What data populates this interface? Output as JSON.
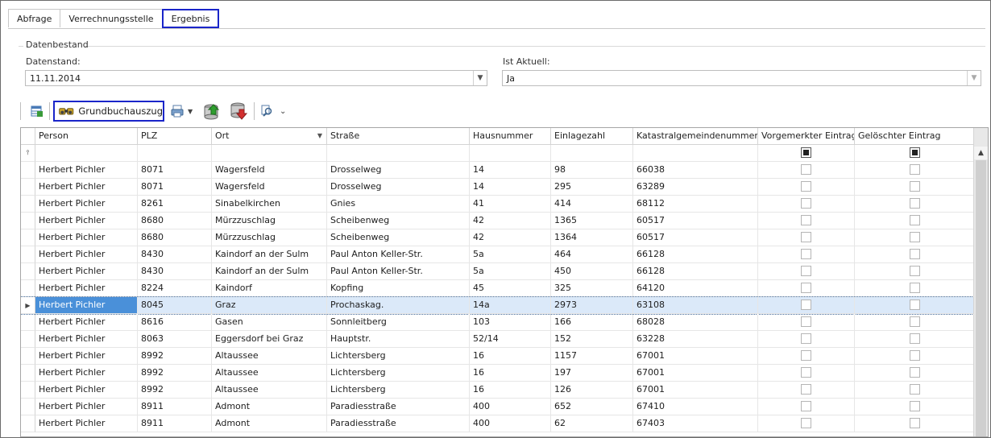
{
  "tabs": [
    {
      "label": "Abfrage",
      "active": false
    },
    {
      "label": "Verrechnungsstelle",
      "active": false
    },
    {
      "label": "Ergebnis",
      "active": true
    }
  ],
  "datenbestand": {
    "legend": "Datenbestand",
    "datenstand_label": "Datenstand:",
    "datenstand_value": "11.11.2014",
    "ist_aktuell_label": "Ist Aktuell:",
    "ist_aktuell_value": "Ja"
  },
  "toolbar": {
    "grundbuchauszug_label": "Grundbuchauszug"
  },
  "grid": {
    "columns": [
      "Person",
      "PLZ",
      "Ort",
      "Straße",
      "Hausnummer",
      "Einlagezahl",
      "Katastralgemeindenummer",
      "Vorgemerkter Eintrag",
      "Gelöschter Eintrag"
    ],
    "rows": [
      [
        "Herbert Pichler",
        "8071",
        "Wagersfeld",
        "Drosselweg",
        "14",
        "98",
        "66038"
      ],
      [
        "Herbert Pichler",
        "8071",
        "Wagersfeld",
        "Drosselweg",
        "14",
        "295",
        "63289"
      ],
      [
        "Herbert Pichler",
        "8261",
        "Sinabelkirchen",
        "Gnies",
        "41",
        "414",
        "68112"
      ],
      [
        "Herbert Pichler",
        "8680",
        "Mürzzuschlag",
        "Scheibenweg",
        "42",
        "1365",
        "60517"
      ],
      [
        "Herbert Pichler",
        "8680",
        "Mürzzuschlag",
        "Scheibenweg",
        "42",
        "1364",
        "60517"
      ],
      [
        "Herbert Pichler",
        "8430",
        "Kaindorf an der Sulm",
        "Paul Anton Keller-Str.",
        "5a",
        "464",
        "66128"
      ],
      [
        "Herbert Pichler",
        "8430",
        "Kaindorf an der Sulm",
        "Paul Anton Keller-Str.",
        "5a",
        "450",
        "66128"
      ],
      [
        "Herbert Pichler",
        "8224",
        "Kaindorf",
        "Kopfing",
        "45",
        "325",
        "64120"
      ],
      [
        "Herbert Pichler",
        "8045",
        "Graz",
        "Prochaskag.",
        "14a",
        "2973",
        "63108"
      ],
      [
        "Herbert Pichler",
        "8616",
        "Gasen",
        "Sonnleitberg",
        "103",
        "166",
        "68028"
      ],
      [
        "Herbert Pichler",
        "8063",
        "Eggersdorf bei Graz",
        "Hauptstr.",
        "52/14",
        "152",
        "63228"
      ],
      [
        "Herbert Pichler",
        "8992",
        "Altaussee",
        "Lichtersberg",
        "16",
        "1157",
        "67001"
      ],
      [
        "Herbert Pichler",
        "8992",
        "Altaussee",
        "Lichtersberg",
        "16",
        "197",
        "67001"
      ],
      [
        "Herbert Pichler",
        "8992",
        "Altaussee",
        "Lichtersberg",
        "16",
        "126",
        "67001"
      ],
      [
        "Herbert Pichler",
        "8911",
        "Admont",
        "Paradiesstraße",
        "400",
        "652",
        "67410"
      ],
      [
        "Herbert Pichler",
        "8911",
        "Admont",
        "Paradiesstraße",
        "400",
        "62",
        "67403"
      ]
    ],
    "selected_row": 8
  }
}
